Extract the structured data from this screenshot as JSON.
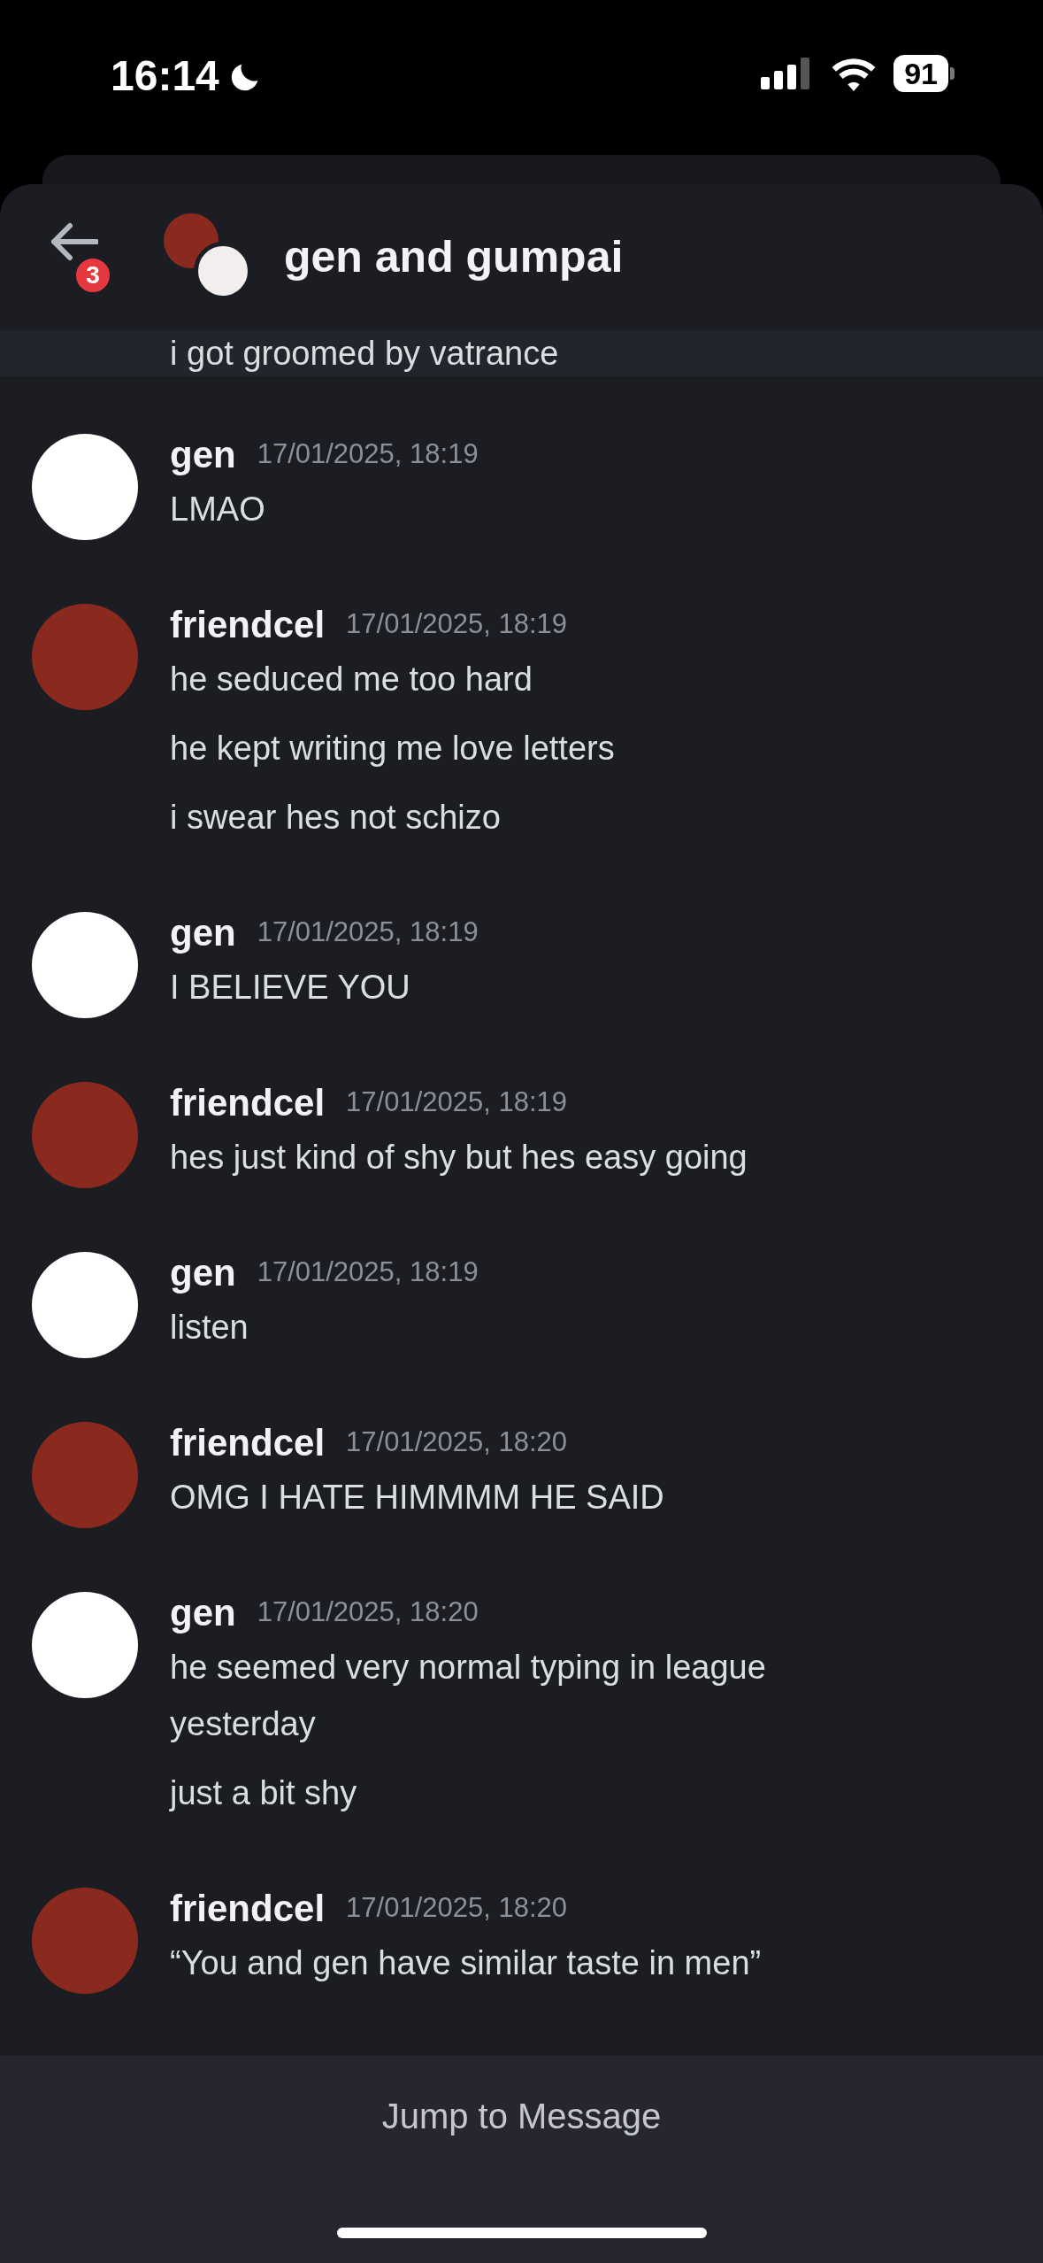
{
  "status_bar": {
    "time": "16:14",
    "battery": "91"
  },
  "header": {
    "title": "gen and gumpai",
    "unread_badge": "3"
  },
  "previous_message": "i got groomed by vatrance",
  "messages": [
    {
      "author": "gen",
      "timestamp": "17/01/2025, 18:19",
      "color": "#ffffff",
      "lines": [
        "LMAO"
      ]
    },
    {
      "author": "friendcel",
      "timestamp": "17/01/2025, 18:19",
      "color": "#8a2a1e",
      "lines": [
        "he seduced me too hard",
        "he kept writing me love letters",
        "i swear hes not schizo"
      ]
    },
    {
      "author": "gen",
      "timestamp": "17/01/2025, 18:19",
      "color": "#ffffff",
      "lines": [
        "I BELIEVE YOU"
      ]
    },
    {
      "author": "friendcel",
      "timestamp": "17/01/2025, 18:19",
      "color": "#8a2a1e",
      "lines": [
        "hes just kind of shy but hes easy going"
      ]
    },
    {
      "author": "gen",
      "timestamp": "17/01/2025, 18:19",
      "color": "#ffffff",
      "lines": [
        "listen"
      ]
    },
    {
      "author": "friendcel",
      "timestamp": "17/01/2025, 18:20",
      "color": "#8a2a1e",
      "lines": [
        "OMG I HATE HIMMMM HE SAID"
      ]
    },
    {
      "author": "gen",
      "timestamp": "17/01/2025, 18:20",
      "color": "#ffffff",
      "lines": [
        "he seemed very normal typing in league yesterday",
        "just a bit shy"
      ]
    },
    {
      "author": "friendcel",
      "timestamp": "17/01/2025, 18:20",
      "color": "#8a2a1e",
      "lines": [
        "“You and gen have similar taste in men”"
      ]
    }
  ],
  "footer": {
    "button": "Jump to Message"
  }
}
